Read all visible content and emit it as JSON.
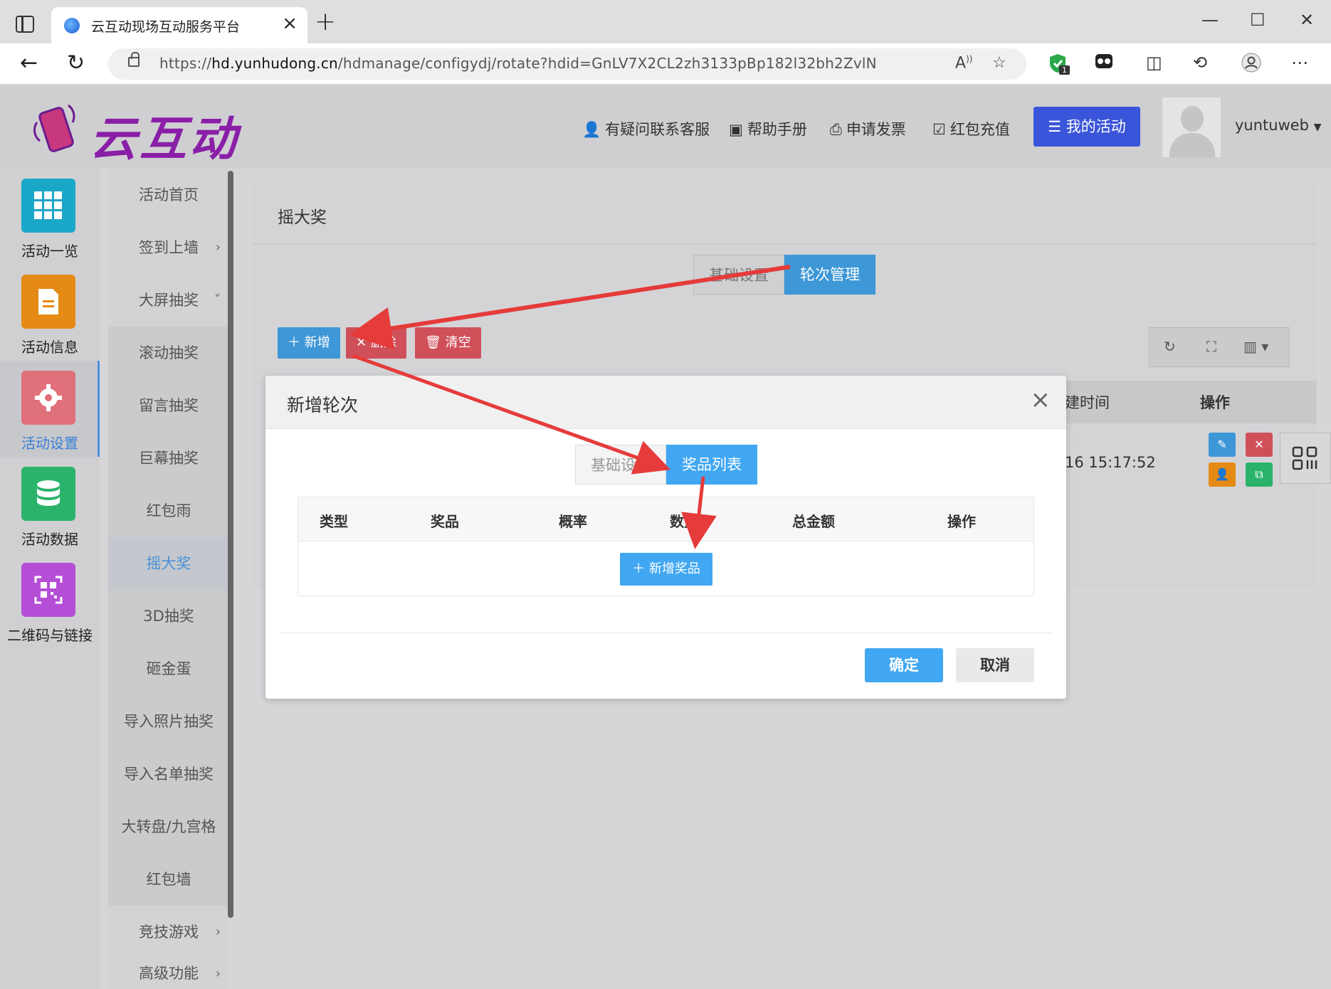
{
  "browser": {
    "tab_title": "云互动现场互动服务平台",
    "url_prefix": "https://",
    "url_host": "hd.yunhudong.cn",
    "url_path": "/hdmanage/configydj/rotate?hdid=GnLV7X2CL2zh3133pBp182l32bh2ZvlN",
    "ext_badge": "1"
  },
  "header": {
    "logo_text": "云互动",
    "nav": [
      {
        "label": "有疑问联系客服",
        "icon": "user-plus-icon"
      },
      {
        "label": "帮助手册",
        "icon": "book-icon"
      },
      {
        "label": "申请发票",
        "icon": "printer-icon"
      },
      {
        "label": "红包充值",
        "icon": "check-shield-icon"
      }
    ],
    "my_activity": "我的活动",
    "username": "yuntuweb"
  },
  "iconbar": {
    "items": [
      {
        "label": "活动一览",
        "color": "#1aa7c9",
        "icon": "grid-icon"
      },
      {
        "label": "活动信息",
        "color": "#e58a14",
        "icon": "document-icon"
      },
      {
        "label": "活动设置",
        "color": "#e0707a",
        "icon": "gear-icon"
      },
      {
        "label": "活动数据",
        "color": "#2bb36b",
        "icon": "database-icon"
      },
      {
        "label": "二维码与链接",
        "color": "#b54ed6",
        "icon": "qrcode-icon"
      }
    ]
  },
  "submenu": {
    "items": [
      "活动首页",
      "签到上墙",
      "大屏抽奖",
      "滚动抽奖",
      "留言抽奖",
      "巨幕抽奖",
      "红包雨",
      "摇大奖",
      "3D抽奖",
      "砸金蛋",
      "导入照片抽奖",
      "导入名单抽奖",
      "大转盘/九宫格",
      "红包墙",
      "竞技游戏",
      "高级功能"
    ]
  },
  "panel": {
    "title": "摇大奖",
    "seg_basic": "基础设置",
    "seg_rounds": "轮次管理",
    "btn_add": "新增",
    "btn_delete": "删除",
    "btn_clear": "清空",
    "col_time_partial": "建时间",
    "col_ops": "操作",
    "row_time_partial": "16 15:17:52"
  },
  "modal": {
    "title": "新增轮次",
    "seg_basic": "基础设置",
    "seg_prizes": "奖品列表",
    "columns": [
      "类型",
      "奖品",
      "概率",
      "数量",
      "总金额",
      "操作"
    ],
    "add_prize": "新增奖品",
    "ok": "确定",
    "cancel": "取消"
  }
}
